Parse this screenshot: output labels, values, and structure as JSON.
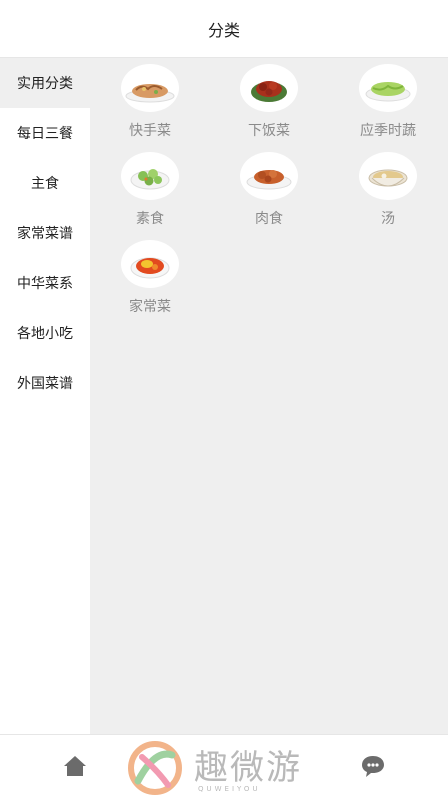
{
  "header": {
    "title": "分类"
  },
  "sidebar": {
    "items": [
      {
        "label": "实用分类",
        "active": true
      },
      {
        "label": "每日三餐",
        "active": false
      },
      {
        "label": "主食",
        "active": false
      },
      {
        "label": "家常菜谱",
        "active": false
      },
      {
        "label": "中华菜系",
        "active": false
      },
      {
        "label": "各地小吃",
        "active": false
      },
      {
        "label": "外国菜谱",
        "active": false
      }
    ]
  },
  "categories": [
    {
      "label": "快手菜",
      "icon": "stir-fry-dish-icon"
    },
    {
      "label": "下饭菜",
      "icon": "braised-meat-dish-icon"
    },
    {
      "label": "应季时蔬",
      "icon": "green-vegetable-dish-icon"
    },
    {
      "label": "素食",
      "icon": "vegetable-dish-icon"
    },
    {
      "label": "肉食",
      "icon": "meat-dish-icon"
    },
    {
      "label": "汤",
      "icon": "soup-bowl-icon"
    },
    {
      "label": "家常菜",
      "icon": "home-style-dish-icon"
    }
  ],
  "tabbar": {
    "home_icon": "home-icon",
    "chat_icon": "chat-icon"
  },
  "watermark": {
    "text": "趣微游",
    "subtext": "QUWEIYOU"
  },
  "colors": {
    "sidebar_active_bg": "#efefef",
    "content_bg": "#efefef",
    "label_gray": "#8a8a8a"
  }
}
